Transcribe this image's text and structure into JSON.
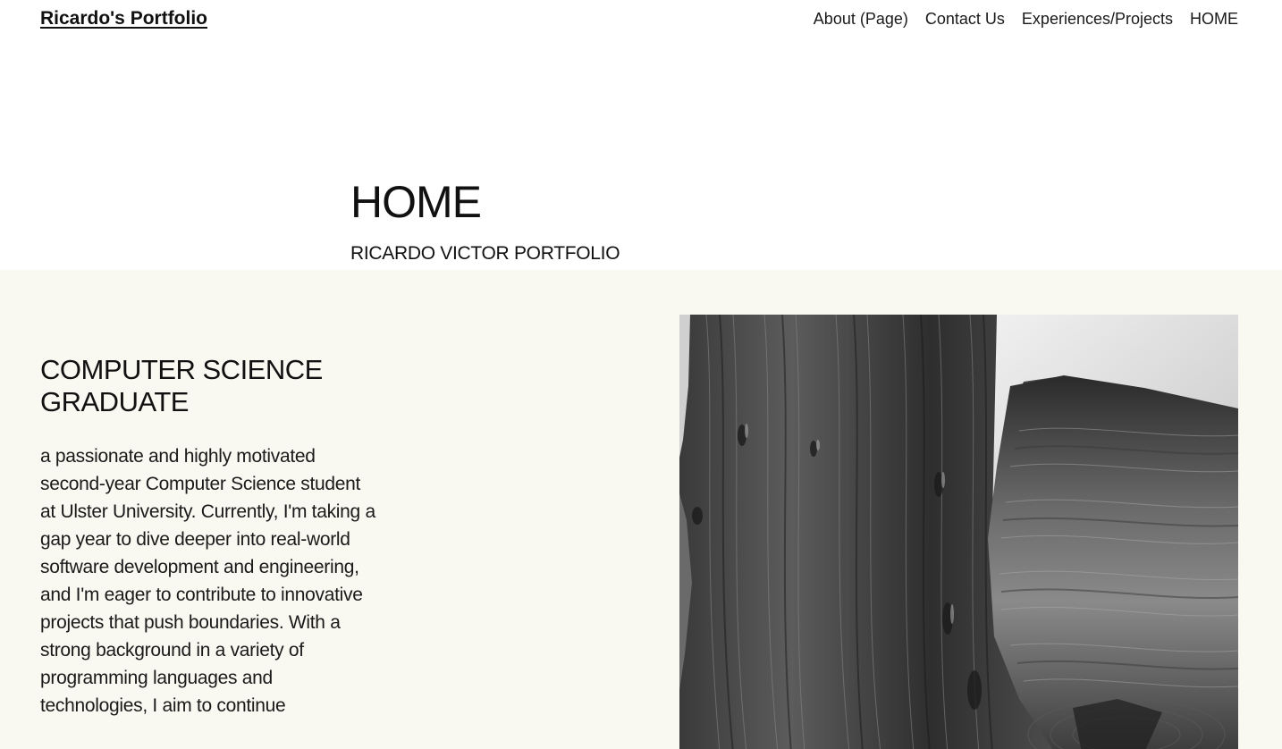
{
  "header": {
    "site_title": "Ricardo's Portfolio",
    "nav": [
      {
        "label": "About (Page)"
      },
      {
        "label": "Contact Us"
      },
      {
        "label": "Experiences/Projects"
      },
      {
        "label": "HOME"
      }
    ]
  },
  "hero": {
    "title": "HOME",
    "subtitle": "RICARDO VICTOR PORTFOLIO"
  },
  "section": {
    "heading": "COMPUTER SCIENCE GRADUATE",
    "body": "a passionate and highly motivated second-year Computer Science student at Ulster University. Currently, I'm taking a gap year to dive deeper into real-world software development and engineering, and I'm eager to contribute to innovative projects that push boundaries. With a strong background in a variety of programming languages and technologies, I aim to continue",
    "image_name": "abstract-paint-strokes-image"
  },
  "colors": {
    "section_bg": "#f9f8f1",
    "text": "#111111"
  }
}
